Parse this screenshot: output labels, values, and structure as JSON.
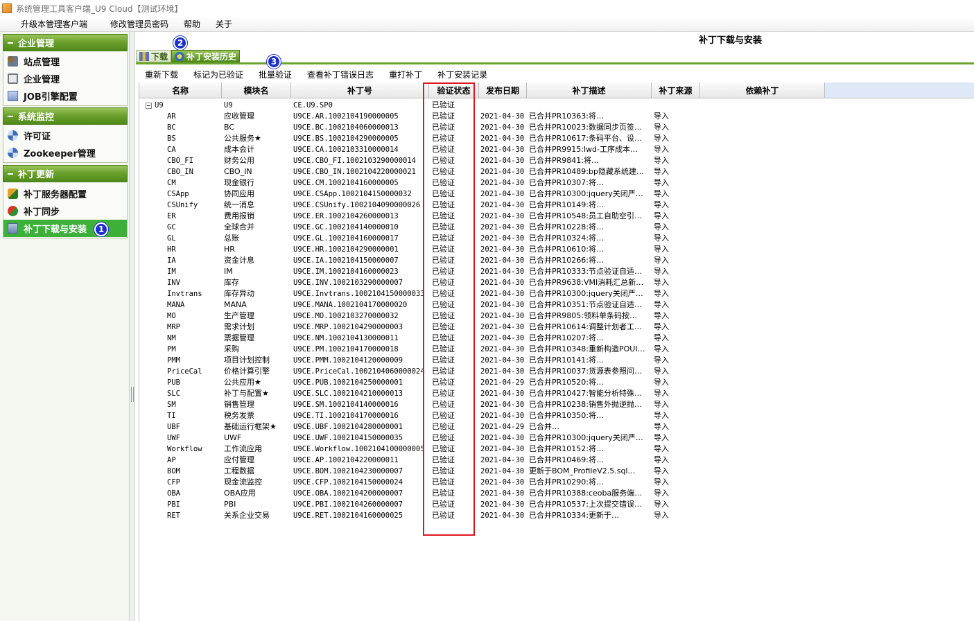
{
  "window": {
    "title": "系统管理工具客户端_U9 Cloud【测试环境】"
  },
  "menu": [
    "升级本管理客户端",
    "修改管理员密码",
    "帮助",
    "关于"
  ],
  "sidebar": {
    "sections": [
      {
        "title": "企业管理",
        "items": [
          "站点管理",
          "企业管理",
          "JOB引擎配置"
        ]
      },
      {
        "title": "系统监控",
        "items": [
          "许可证",
          "Zookeeper管理"
        ]
      },
      {
        "title": "补丁更新",
        "items": [
          "补丁服务器配置",
          "补丁同步",
          "补丁下载与安装"
        ]
      }
    ],
    "active_item": "补丁下载与安装"
  },
  "badges": {
    "b1": "1",
    "b2": "2",
    "b3": "3"
  },
  "main": {
    "title": "补丁下载与安装",
    "tabs": [
      "下载",
      "补丁安装历史"
    ],
    "toolbar": [
      "重新下载",
      "标记为已验证",
      "批量验证",
      "查看补丁错误日志",
      "重打补丁",
      "补丁安装记录"
    ]
  },
  "grid": {
    "columns": [
      "名称",
      "模块名",
      "补丁号",
      "验证状态",
      "发布日期",
      "补丁描述",
      "补丁来源",
      "依赖补丁"
    ],
    "root": {
      "name": "U9",
      "module": "U9",
      "patch": "CE.U9.SP0",
      "status": "已验证"
    },
    "rows": [
      [
        "AR",
        "应收管理",
        "U9CE.AR.1002104190000005",
        "已验证",
        "2021-04-30",
        "已合并PR10363:将…",
        "导入"
      ],
      [
        "BC",
        "BC",
        "U9CE.BC.1002104060000013",
        "已验证",
        "2021-04-30",
        "已合并PR10023:数据同步页签…",
        "导入"
      ],
      [
        "BS",
        "公共服务★",
        "U9CE.BS.1002104290000005",
        "已验证",
        "2021-04-30",
        "已合并PR10617:条码平台、设…",
        "导入"
      ],
      [
        "CA",
        "成本会计",
        "U9CE.CA.1002103310000014",
        "已验证",
        "2021-04-30",
        "已合并PR9915:lwd-工序成本…",
        "导入"
      ],
      [
        "CBO_FI",
        "财务公用",
        "U9CE.CBO_FI.1002103290000014",
        "已验证",
        "2021-04-30",
        "已合并PR9841:将…",
        "导入"
      ],
      [
        "CBO_IN",
        "CBO_IN",
        "U9CE.CBO_IN.1002104220000021",
        "已验证",
        "2021-04-30",
        "已合并PR10489:bp隐藏系统建…",
        "导入"
      ],
      [
        "CM",
        "现金银行",
        "U9CE.CM.1002104160000005",
        "已验证",
        "2021-04-30",
        "已合并PR10307:将…",
        "导入"
      ],
      [
        "CSApp",
        "协同应用",
        "U9CE.CSApp.1002104150000032",
        "已验证",
        "2021-04-30",
        "已合并PR10300:jquery关闭严…",
        "导入"
      ],
      [
        "CSUnify",
        "统一消息",
        "U9CE.CSUnify.1002104090000026",
        "已验证",
        "2021-04-30",
        "已合并PR10149:将…",
        "导入"
      ],
      [
        "ER",
        "费用报销",
        "U9CE.ER.1002104260000013",
        "已验证",
        "2021-04-30",
        "已合并PR10548:员工自助空引…",
        "导入"
      ],
      [
        "GC",
        "全球合并",
        "U9CE.GC.1002104140000010",
        "已验证",
        "2021-04-30",
        "已合并PR10228:将…",
        "导入"
      ],
      [
        "GL",
        "总账",
        "U9CE.GL.1002104160000017",
        "已验证",
        "2021-04-30",
        "已合并PR10324:将…",
        "导入"
      ],
      [
        "HR",
        "HR",
        "U9CE.HR.1002104290000001",
        "已验证",
        "2021-04-30",
        "已合并PR10610:将…",
        "导入"
      ],
      [
        "IA",
        "资金计息",
        "U9CE.IA.1002104150000007",
        "已验证",
        "2021-04-30",
        "已合并PR10266:将…",
        "导入"
      ],
      [
        "IM",
        "IM",
        "U9CE.IM.1002104160000023",
        "已验证",
        "2021-04-30",
        "已合并PR10333:节点验证自适…",
        "导入"
      ],
      [
        "INV",
        "库存",
        "U9CE.INV.1002103290000007",
        "已验证",
        "2021-04-30",
        "已合并PR9638:VMI消耗汇总新…",
        "导入"
      ],
      [
        "Invtrans",
        "库存异动",
        "U9CE.Invtrans.1002104150000033",
        "已验证",
        "2021-04-30",
        "已合并PR10300:jquery关闭严…",
        "导入"
      ],
      [
        "MANA",
        "MANA",
        "U9CE.MANA.1002104170000020",
        "已验证",
        "2021-04-30",
        "已合并PR10351:节点验证自适…",
        "导入"
      ],
      [
        "MO",
        "生产管理",
        "U9CE.MO.1002103270000032",
        "已验证",
        "2021-04-30",
        "已合并PR9805:领料单条码按…",
        "导入"
      ],
      [
        "MRP",
        "需求计划",
        "U9CE.MRP.1002104290000003",
        "已验证",
        "2021-04-30",
        "已合并PR10614:调整计划者工…",
        "导入"
      ],
      [
        "NM",
        "票据管理",
        "U9CE.NM.1002104130000011",
        "已验证",
        "2021-04-30",
        "已合并PR10207:将…",
        "导入"
      ],
      [
        "PM",
        "采购",
        "U9CE.PM.1002104170000018",
        "已验证",
        "2021-04-30",
        "已合并PR10348:重新构造POUI…",
        "导入"
      ],
      [
        "PMM",
        "项目计划控制",
        "U9CE.PMM.1002104120000009",
        "已验证",
        "2021-04-30",
        "已合并PR10141:将…",
        "导入"
      ],
      [
        "PriceCal",
        "价格计算引擎",
        "U9CE.PriceCal.1002104060000024",
        "已验证",
        "2021-04-30",
        "已合并PR10037:货源表参照问…",
        "导入"
      ],
      [
        "PUB",
        "公共应用★",
        "U9CE.PUB.1002104250000001",
        "已验证",
        "2021-04-29",
        "已合并PR10520:将…",
        "导入"
      ],
      [
        "SLC",
        "补丁与配置★",
        "U9CE.SLC.1002104210000013",
        "已验证",
        "2021-04-30",
        "已合并PR10427:智能分析特殊…",
        "导入"
      ],
      [
        "SM",
        "销售管理",
        "U9CE.SM.1002104140000016",
        "已验证",
        "2021-04-30",
        "已合并PR10238:销售外抛逆抛…",
        "导入"
      ],
      [
        "TI",
        "税务发票",
        "U9CE.TI.1002104170000016",
        "已验证",
        "2021-04-30",
        "已合并PR10350:将…",
        "导入"
      ],
      [
        "UBF",
        "基础运行框架★",
        "U9CE.UBF.1002104280000001",
        "已验证",
        "2021-04-29",
        "已合并…",
        "导入"
      ],
      [
        "UWF",
        "UWF",
        "U9CE.UWF.1002104150000035",
        "已验证",
        "2021-04-30",
        "已合并PR10300:jquery关闭严…",
        "导入"
      ],
      [
        "Workflow",
        "工作流应用",
        "U9CE.Workflow.1002104100000005",
        "已验证",
        "2021-04-30",
        "已合并PR10152:将…",
        "导入"
      ],
      [
        "AP",
        "应付管理",
        "U9CE.AP.1002104220000011",
        "已验证",
        "2021-04-30",
        "已合并PR10469:将…",
        "导入"
      ],
      [
        "BOM",
        "工程数据",
        "U9CE.BOM.1002104230000007",
        "已验证",
        "2021-04-30",
        "更新于BOM_ProfileV2.5.sql…",
        "导入"
      ],
      [
        "CFP",
        "现金流监控",
        "U9CE.CFP.1002104150000024",
        "已验证",
        "2021-04-30",
        "已合并PR10290:将…",
        "导入"
      ],
      [
        "OBA",
        "OBA应用",
        "U9CE.OBA.1002104200000007",
        "已验证",
        "2021-04-30",
        "已合并PR10388:ceoba服务端…",
        "导入"
      ],
      [
        "PBI",
        "PBI",
        "U9CE.PBI.1002104260000007",
        "已验证",
        "2021-04-30",
        "已合并PR10537:上次提交错误…",
        "导入"
      ],
      [
        "RET",
        "关系企业交易",
        "U9CE.RET.1002104160000025",
        "已验证",
        "2021-04-30",
        "已合并PR10334:更新于…",
        "导入"
      ]
    ]
  }
}
